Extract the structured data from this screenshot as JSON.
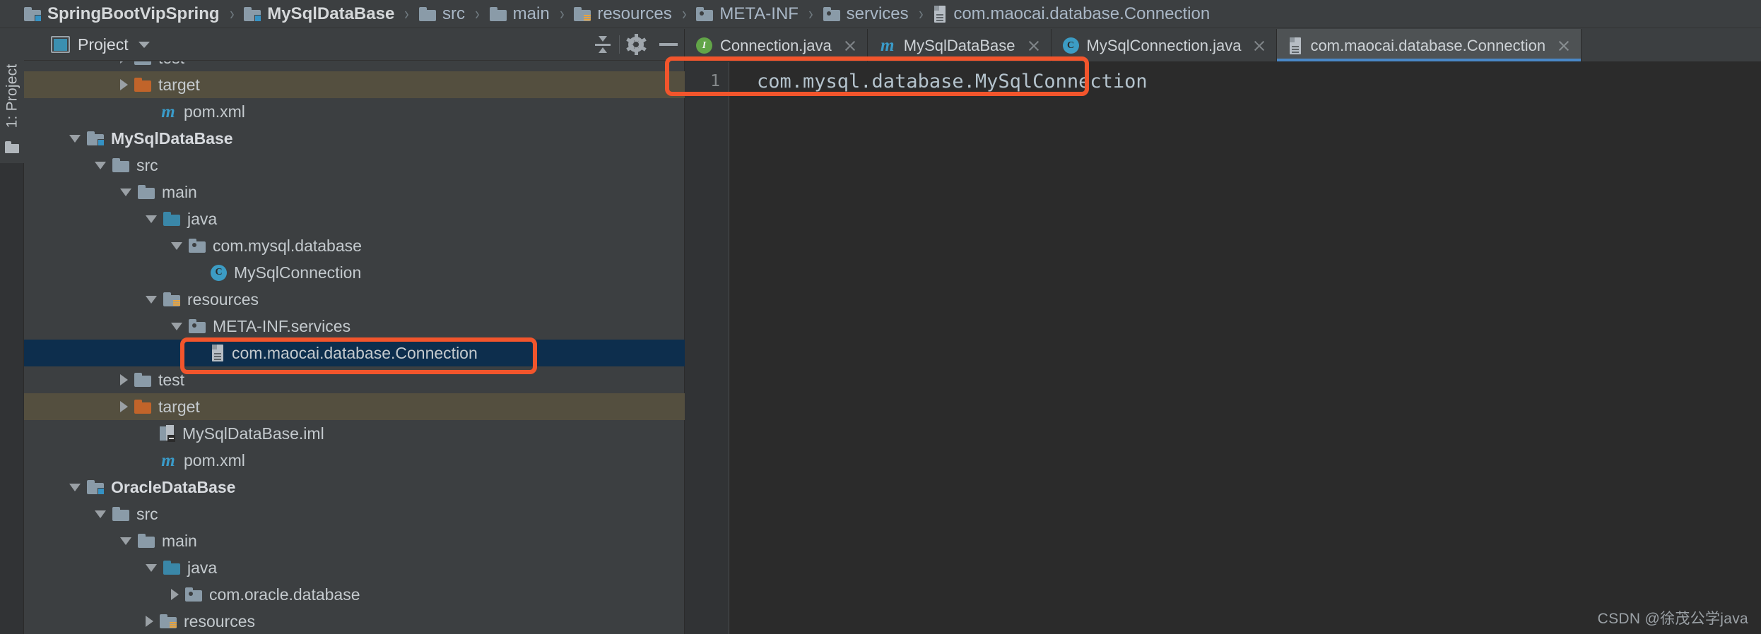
{
  "breadcrumb": {
    "items": [
      {
        "label": "SpringBootVipSpring",
        "icon": "module-folder-icon",
        "bold": true
      },
      {
        "label": "MySqlDataBase",
        "icon": "module-folder-icon",
        "bold": true
      },
      {
        "label": "src",
        "icon": "folder-icon",
        "bold": false
      },
      {
        "label": "main",
        "icon": "folder-icon",
        "bold": false
      },
      {
        "label": "resources",
        "icon": "resources-folder-icon",
        "bold": false
      },
      {
        "label": "META-INF",
        "icon": "package-folder-icon",
        "bold": false
      },
      {
        "label": "services",
        "icon": "package-folder-icon",
        "bold": false
      },
      {
        "label": "com.maocai.database.Connection",
        "icon": "file-icon",
        "bold": false
      }
    ],
    "separator": "›"
  },
  "toolstrip": {
    "project_tab_label": "1: Project",
    "project_tab_icon": "folder-icon"
  },
  "project_panel": {
    "title": "Project",
    "title_icon": "project-view-icon",
    "dropdown_icon": "chevron-down-icon",
    "actions": [
      {
        "name": "collapse-all",
        "icon": "collapse-all-icon"
      },
      {
        "name": "settings",
        "icon": "gear-icon"
      },
      {
        "name": "hide",
        "icon": "minimize-icon"
      }
    ]
  },
  "tree": [
    {
      "label": "test",
      "icon": "folder-icon",
      "indent": 3,
      "arrow": "closed",
      "state": "clipped",
      "bold": false
    },
    {
      "label": "target",
      "icon": "orange-folder-icon",
      "indent": 3,
      "arrow": "closed",
      "state": "excluded",
      "bold": false
    },
    {
      "label": "pom.xml",
      "icon": "maven-icon",
      "indent": 4,
      "arrow": "none",
      "state": "normal",
      "bold": false
    },
    {
      "label": "MySqlDataBase",
      "icon": "module-folder-icon",
      "indent": 1,
      "arrow": "open",
      "state": "normal",
      "bold": true
    },
    {
      "label": "src",
      "icon": "folder-icon",
      "indent": 2,
      "arrow": "open",
      "state": "normal",
      "bold": false
    },
    {
      "label": "main",
      "icon": "folder-icon",
      "indent": 3,
      "arrow": "open",
      "state": "normal",
      "bold": false
    },
    {
      "label": "java",
      "icon": "source-folder-icon",
      "indent": 4,
      "arrow": "open",
      "state": "normal",
      "bold": false
    },
    {
      "label": "com.mysql.database",
      "icon": "package-folder-icon",
      "indent": 5,
      "arrow": "open",
      "state": "normal",
      "bold": false
    },
    {
      "label": "MySqlConnection",
      "icon": "class-icon",
      "indent": 6,
      "arrow": "none",
      "state": "normal",
      "bold": false
    },
    {
      "label": "resources",
      "icon": "resources-folder-icon",
      "indent": 4,
      "arrow": "open",
      "state": "normal",
      "bold": false
    },
    {
      "label": "META-INF.services",
      "icon": "package-folder-icon",
      "indent": 5,
      "arrow": "open",
      "state": "normal",
      "bold": false
    },
    {
      "label": "com.maocai.database.Connection",
      "icon": "file-icon",
      "indent": 6,
      "arrow": "none",
      "state": "selected",
      "bold": false
    },
    {
      "label": "test",
      "icon": "folder-icon",
      "indent": 3,
      "arrow": "closed",
      "state": "normal",
      "bold": false
    },
    {
      "label": "target",
      "icon": "orange-folder-icon",
      "indent": 3,
      "arrow": "closed",
      "state": "excluded",
      "bold": false
    },
    {
      "label": "MySqlDataBase.iml",
      "icon": "iml-icon",
      "indent": 4,
      "arrow": "none",
      "state": "normal",
      "bold": false
    },
    {
      "label": "pom.xml",
      "icon": "maven-icon",
      "indent": 4,
      "arrow": "none",
      "state": "normal",
      "bold": false
    },
    {
      "label": "OracleDataBase",
      "icon": "module-folder-icon",
      "indent": 1,
      "arrow": "open",
      "state": "normal",
      "bold": true
    },
    {
      "label": "src",
      "icon": "folder-icon",
      "indent": 2,
      "arrow": "open",
      "state": "normal",
      "bold": false
    },
    {
      "label": "main",
      "icon": "folder-icon",
      "indent": 3,
      "arrow": "open",
      "state": "normal",
      "bold": false
    },
    {
      "label": "java",
      "icon": "source-folder-icon",
      "indent": 4,
      "arrow": "open",
      "state": "normal",
      "bold": false
    },
    {
      "label": "com.oracle.database",
      "icon": "package-folder-icon",
      "indent": 5,
      "arrow": "closed",
      "state": "normal",
      "bold": false
    },
    {
      "label": "resources",
      "icon": "resources-folder-icon",
      "indent": 4,
      "arrow": "closed",
      "state": "normal",
      "bold": false
    }
  ],
  "editor": {
    "tabs": [
      {
        "label": "Connection.java",
        "icon": "interface-icon",
        "active": false,
        "closable": true
      },
      {
        "label": "MySqlDataBase",
        "icon": "maven-icon",
        "active": false,
        "closable": true
      },
      {
        "label": "MySqlConnection.java",
        "icon": "class-icon",
        "active": false,
        "closable": true
      },
      {
        "label": "com.maocai.database.Connection",
        "icon": "file-icon",
        "active": true,
        "closable": true
      }
    ],
    "line_numbers": [
      "1"
    ],
    "lines": [
      "com.mysql.database.MySqlConnection"
    ]
  },
  "annotations": {
    "accent_color": "#f2552c",
    "boxes": [
      {
        "name": "tree-selected-highlight",
        "target": "com.maocai.database.Connection"
      },
      {
        "name": "code-line-highlight",
        "target": "com.mysql.database.MySqlConnection"
      }
    ]
  },
  "watermark": {
    "text": "CSDN @徐茂公学java"
  },
  "colors": {
    "background": "#3c3f41",
    "editor_background": "#2b2b2b",
    "selection": "#0d2e4d",
    "excluded": "#544f3f",
    "accent_blue": "#4a88c7",
    "text": "#c4cace"
  }
}
